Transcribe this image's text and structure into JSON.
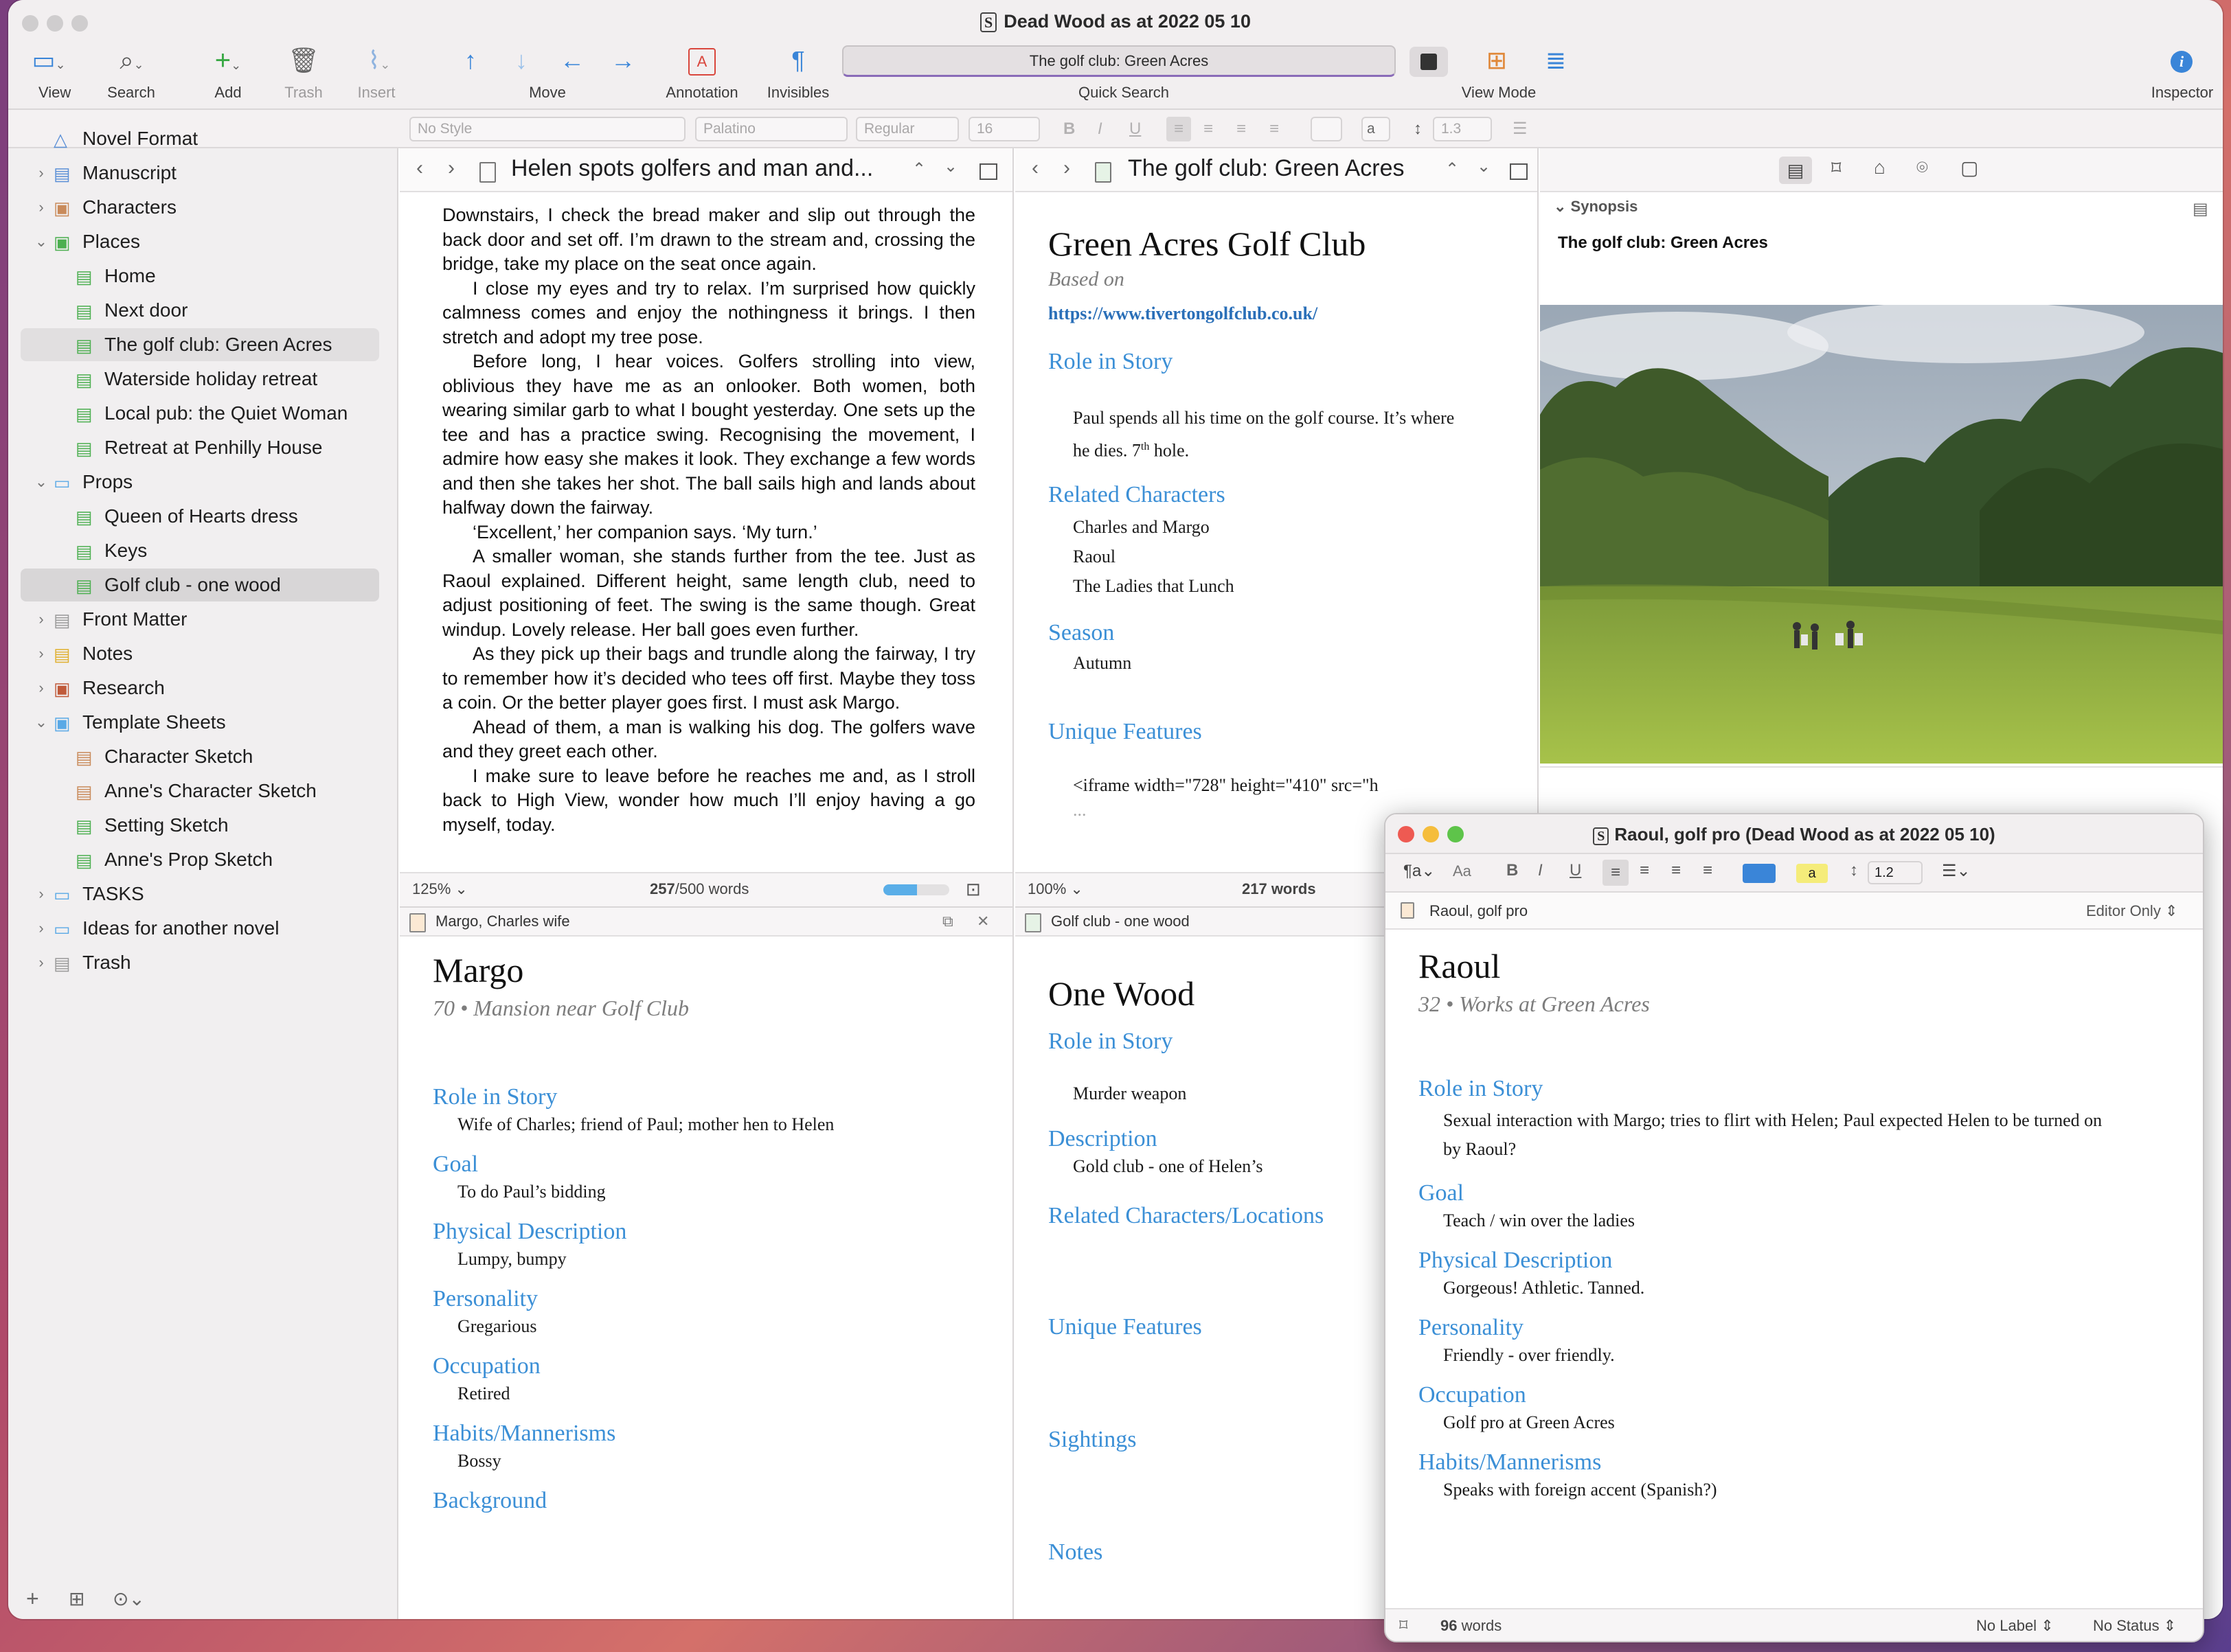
{
  "window": {
    "title": "Dead Wood as at 2022 05 10",
    "toolbar": {
      "view": "View",
      "search": "Search",
      "add": "Add",
      "trash": "Trash",
      "insert": "Insert",
      "move": "Move",
      "annotation": "Annotation",
      "invisibles": "Invisibles",
      "quick_search": "Quick Search",
      "quick_search_value": "The golf club: Green Acres",
      "view_mode": "View Mode",
      "inspector": "Inspector"
    },
    "format_bar": {
      "style": "No Style",
      "font": "Palatino",
      "weight": "Regular",
      "size": "16",
      "highlight_letter": "a",
      "line_spacing": "1.3"
    }
  },
  "binder": {
    "items": [
      {
        "label": "Novel Format"
      },
      {
        "label": "Manuscript"
      },
      {
        "label": "Characters"
      },
      {
        "label": "Places"
      },
      {
        "label": "Home"
      },
      {
        "label": "Next door"
      },
      {
        "label": "The golf club: Green Acres"
      },
      {
        "label": "Waterside holiday retreat"
      },
      {
        "label": "Local pub: the Quiet Woman"
      },
      {
        "label": "Retreat at Penhilly House"
      },
      {
        "label": "Props"
      },
      {
        "label": "Queen of Hearts dress"
      },
      {
        "label": "Keys"
      },
      {
        "label": "Golf club - one wood"
      },
      {
        "label": "Front Matter"
      },
      {
        "label": "Notes"
      },
      {
        "label": "Research"
      },
      {
        "label": "Template Sheets"
      },
      {
        "label": "Character Sketch"
      },
      {
        "label": "Anne's Character Sketch"
      },
      {
        "label": "Setting Sketch"
      },
      {
        "label": "Anne's Prop Sketch"
      },
      {
        "label": "TASKS"
      },
      {
        "label": "Ideas for another novel"
      },
      {
        "label": "Trash"
      }
    ]
  },
  "pane_left": {
    "title": "Helen spots golfers and man and...",
    "paragraphs": [
      "Downstairs, I check the bread maker and slip out through the back door and set off. I’m drawn to the stream and, crossing the bridge, take my place on the seat once again.",
      "I close my eyes and try to relax. I’m surprised how quickly calmness comes and enjoy the nothingness it brings. I then stretch and adopt my tree pose.",
      "Before long, I hear voices. Golfers strolling into view, oblivious they have me as an onlooker. Both women, both wearing similar garb to what I bought yesterday. One sets up the tee and has a practice swing. Recognising the movement, I admire how easy she makes it look. They exchange a few words and then she takes her shot. The ball sails high and lands about halfway down the fairway.",
      "‘Excellent,’ her companion says. ‘My turn.’",
      "A smaller woman, she stands further from the tee. Just as Raoul explained. Different height, same length club, need to adjust positioning of feet. The swing is the same though. Great windup. Lovely release. Her ball goes even further.",
      "As they pick up their bags and trundle along the fairway, I try to remember how it’s decided who tees off first. Maybe they toss a coin. Or the better player goes first. I must ask Margo.",
      "Ahead of them, a man is walking his dog. The golfers wave and they greet each other.",
      "I make sure to leave before he reaches me and, as I stroll back to High View, wonder how much I’ll enjoy having a go myself, today."
    ],
    "zoom": "125%",
    "word_count": "257",
    "word_target": "/500 words",
    "progress": 0.51
  },
  "pane_mid": {
    "title": "The golf club: Green Acres",
    "heading": "Green Acres Golf Club",
    "based_on": "Based on",
    "link": "https://www.tivertongolfclub.co.uk/",
    "role_h": "Role in Story",
    "role_a": "Paul spends all his time on the golf course. It’s where",
    "role_b": "he dies. 7",
    "role_sup": "th",
    "role_c": " hole.",
    "related_h": "Related Characters",
    "related": [
      "Charles and Margo",
      "Raoul",
      "The Ladies that Lunch"
    ],
    "season_h": "Season",
    "season": "Autumn",
    "unique_h": "Unique Features",
    "iframe_a": "<iframe width=\"728\" height=\"410\" src=\"h",
    "iframe_b": "...",
    "zoom": "100%",
    "word_count": "217 words"
  },
  "inspector": {
    "synopsis_label": "Synopsis",
    "synopsis_title": "The golf club: Green Acres"
  },
  "pane_bl": {
    "subheader": "Margo, Charles wife",
    "name": "Margo",
    "meta": "70 • Mansion near Golf Club",
    "sections": [
      {
        "h": "Role in Story",
        "v": "Wife of Charles; friend of Paul; mother hen to Helen"
      },
      {
        "h": "Goal",
        "v": "To do Paul’s bidding"
      },
      {
        "h": "Physical Description",
        "v": "Lumpy, bumpy"
      },
      {
        "h": "Personality",
        "v": "Gregarious"
      },
      {
        "h": "Occupation",
        "v": "Retired"
      },
      {
        "h": "Habits/Mannerisms",
        "v": "Bossy"
      },
      {
        "h": "Background",
        "v": ""
      }
    ]
  },
  "pane_bm": {
    "subheader": "Golf club - one wood",
    "name": "One Wood",
    "role_h": "Role in Story",
    "role": "Murder weapon",
    "desc_h": "Description",
    "desc": "Gold club - one of Helen’s",
    "related_h": "Related Characters/Locations",
    "unique_h": "Unique Features",
    "sightings_h": "Sightings",
    "notes_h": "Notes"
  },
  "float_win": {
    "title": "Raoul, golf pro (Dead Wood as at 2022 05 10)",
    "line_spacing": "1.2",
    "doc_label": "Raoul, golf pro",
    "editor_mode": "Editor Only",
    "name": "Raoul",
    "meta": "32 • Works at Green Acres",
    "role_h": "Role in Story",
    "role_a": "Sexual interaction with Margo; tries to flirt with Helen; Paul expected Helen to be turned on",
    "role_b": "by Raoul?",
    "sections": [
      {
        "h": "Goal",
        "v": "Teach / win over the ladies"
      },
      {
        "h": "Physical Description",
        "v": "Gorgeous! Athletic. Tanned."
      },
      {
        "h": "Personality",
        "v": "Friendly - over friendly."
      },
      {
        "h": "Occupation",
        "v": "Golf pro at Green Acres"
      },
      {
        "h": "Habits/Mannerisms",
        "v": "Speaks with foreign accent (Spanish?)"
      }
    ],
    "word_count": "96",
    "word_suffix": " words",
    "label": "No Label",
    "status": "No Status"
  }
}
